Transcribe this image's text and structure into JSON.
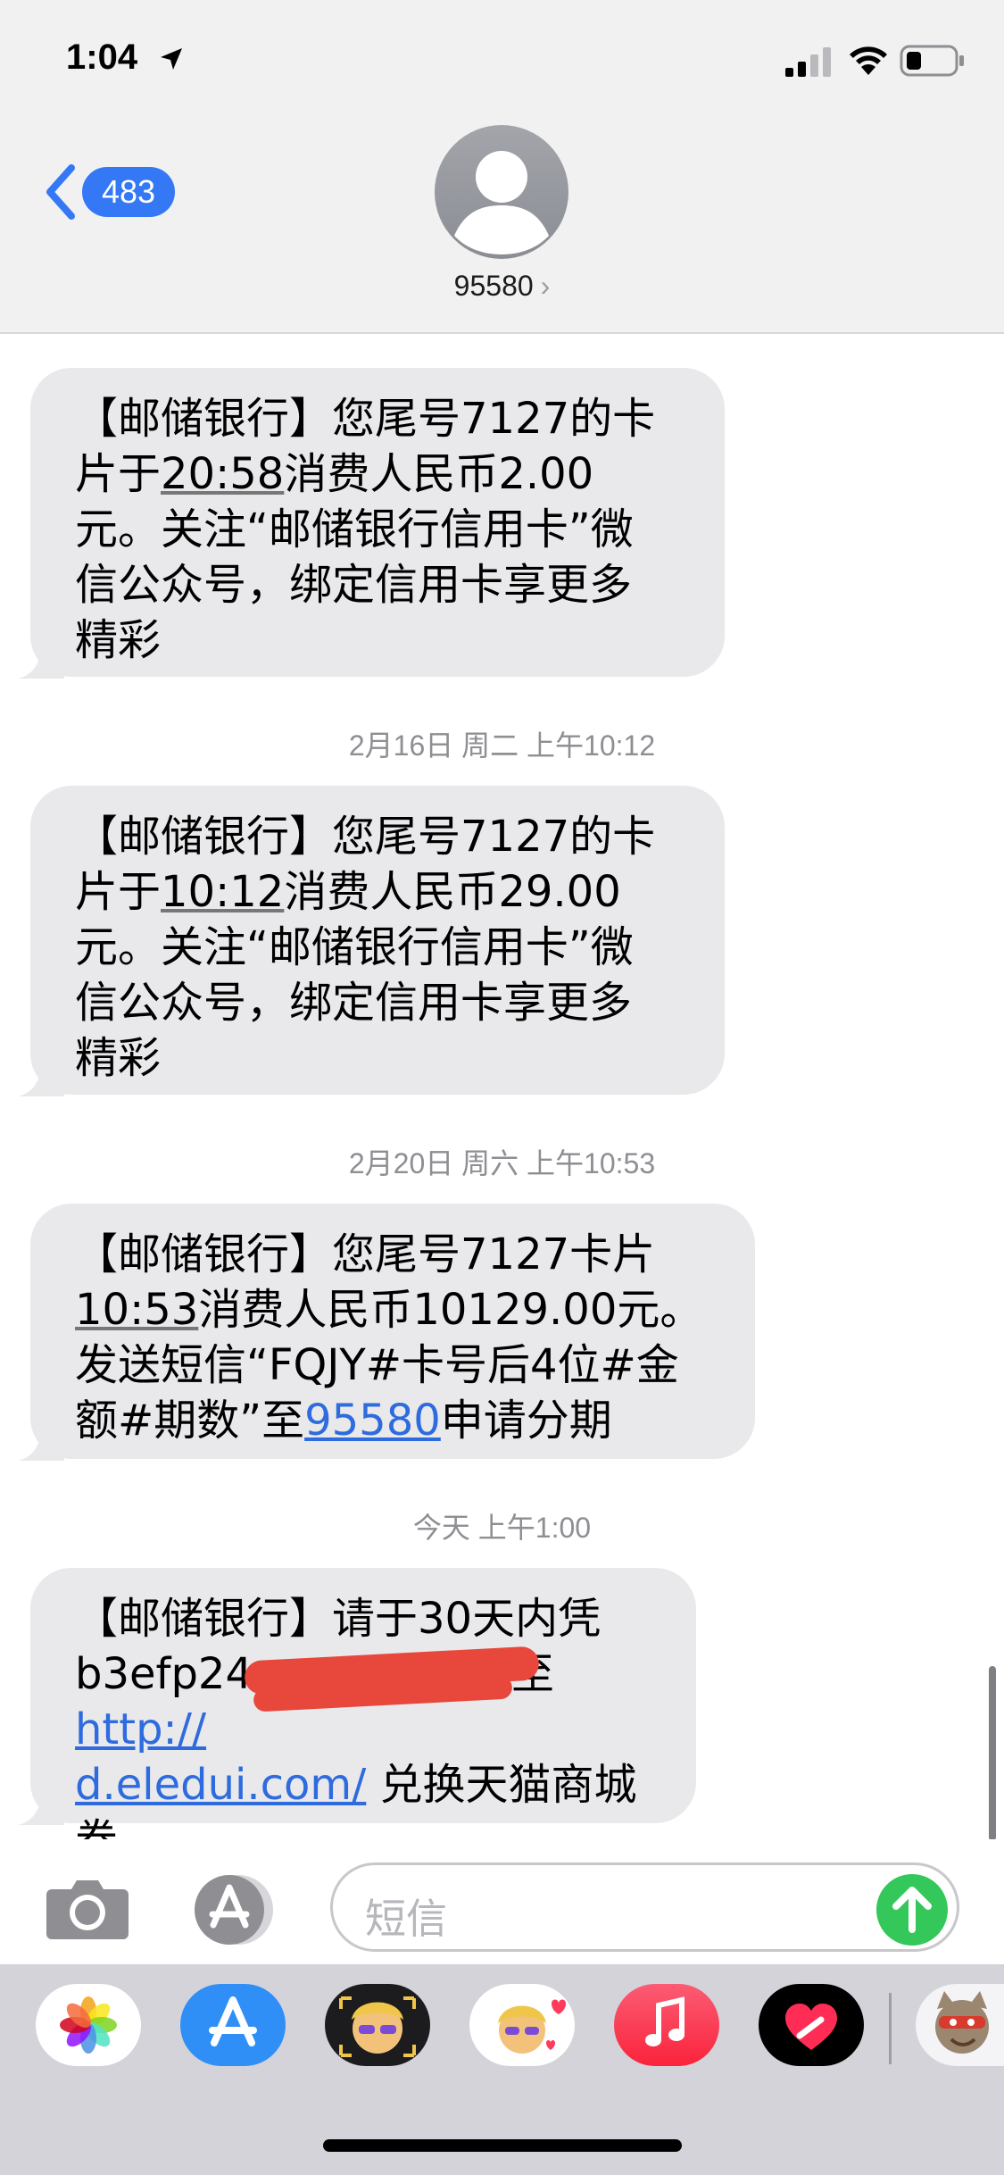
{
  "status": {
    "time": "1:04"
  },
  "header": {
    "back_count": "483",
    "contact_name": "95580",
    "chevron": "›"
  },
  "messages": [
    {
      "stamp": "",
      "parts": [
        "【邮储银行】您尾号7127的卡\n片于",
        "20:58",
        "消费人民币2.00\n元。关注“邮储银行信用卡”微\n信公众号，绑定信用卡享更多\n精彩"
      ]
    },
    {
      "stamp": "2月16日 周二 上午10:12",
      "parts": [
        "【邮储银行】您尾号7127的卡\n片于",
        "10:12",
        "消费人民币29.00\n元。关注“邮储银行信用卡”微\n信公众号，绑定信用卡享更多\n精彩"
      ]
    },
    {
      "stamp": "2月20日 周六 上午10:53",
      "parts": [
        "【邮储银行】您尾号7127卡片\n",
        "10:53",
        "消费人民币10129.00元。\n发送短信“FQJY#卡号后4位#金\n额#期数”至",
        "95580",
        "申请分期"
      ]
    },
    {
      "stamp": "今天 上午1:00",
      "parts": [
        "【邮储银行】请于30天内凭\nb3efp24",
        "至",
        "http://\nd.eledui.com/",
        " 兑换天猫商城\n券。"
      ]
    }
  ],
  "compose": {
    "placeholder": "短信"
  },
  "icons": {
    "location": "location-arrow-icon",
    "signal": "cellular-signal-icon",
    "wifi": "wifi-icon",
    "battery": "battery-icon",
    "camera": "camera-icon",
    "appstore": "app-store-icon",
    "send": "send-arrow-icon"
  },
  "colors": {
    "bubble": "#e9e9eb",
    "link": "#2d6bde",
    "accent": "#3478f6",
    "send": "#34c759",
    "redaction": "#e8473c"
  },
  "drawer": {
    "apps": [
      "photos",
      "app-store",
      "memoji-camera",
      "memoji-stickers",
      "music",
      "digital-touch",
      "game"
    ]
  }
}
